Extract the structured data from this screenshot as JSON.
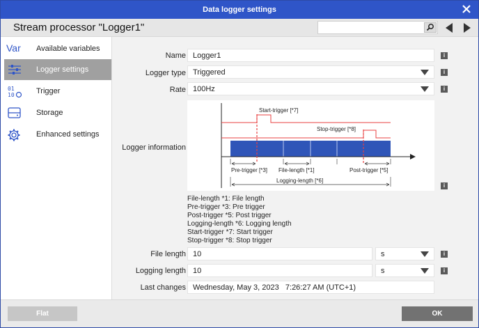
{
  "window": {
    "title": "Data logger settings"
  },
  "header": {
    "title": "Stream processor \"Logger1\"",
    "search_value": ""
  },
  "sidebar": {
    "items": [
      {
        "icon_text": "Var",
        "label": "Available variables"
      },
      {
        "icon_text": "",
        "label": "Logger settings"
      },
      {
        "icon_text": "",
        "label": "Trigger"
      },
      {
        "icon_text": "",
        "label": "Storage"
      },
      {
        "icon_text": "",
        "label": "Enhanced settings"
      }
    ],
    "active_index": 1
  },
  "form": {
    "name": {
      "label": "Name",
      "value": "Logger1"
    },
    "logger_type": {
      "label": "Logger type",
      "value": "Triggered"
    },
    "rate": {
      "label": "Rate",
      "value": "100Hz"
    },
    "logger_information": {
      "label": "Logger information"
    },
    "file_length": {
      "label": "File length",
      "value": "10",
      "unit": "s"
    },
    "logging_length": {
      "label": "Logging length",
      "value": "10",
      "unit": "s"
    },
    "last_changes": {
      "label": "Last changes",
      "value": "Wednesday, May 3, 2023   7:26:27 AM (UTC+1)"
    },
    "info_icon": "i"
  },
  "diagram": {
    "start_trigger": "Start-trigger [*7]",
    "stop_trigger": "Stop-trigger [*8]",
    "pre_trigger": "Pre-trigger [*3]",
    "file_length": "File-length [*1]",
    "post_trigger": "Post-trigger [*5]",
    "logging_length": "Logging-length [*6]",
    "colors": {
      "bar": "#2f55b8",
      "signal": "#e84040",
      "axis": "#222222"
    }
  },
  "legend": [
    "File-length   *1: File length",
    "Pre-trigger   *3: Pre trigger",
    "Post-trigger   *5: Post trigger",
    "Logging-length   *6: Logging length",
    "Start-trigger   *7: Start trigger",
    "Stop-trigger   *8: Stop trigger"
  ],
  "footer": {
    "flat_label": "Flat",
    "ok_label": "OK"
  }
}
